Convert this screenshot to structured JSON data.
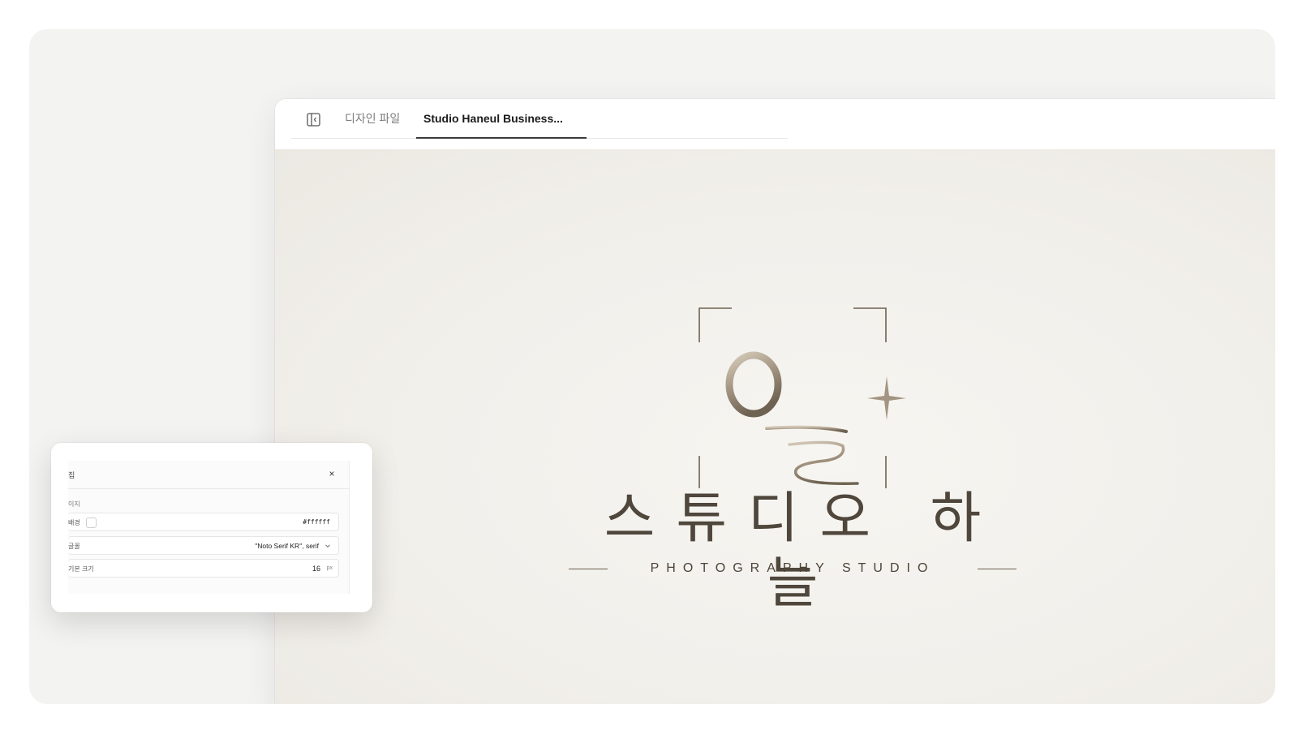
{
  "tabs": {
    "files_label": "디자인 파일",
    "active_label": "Studio Haneul Business..."
  },
  "logo": {
    "korean_name": "스튜디오 하늘",
    "tagline": "PHOTOGRAPHY STUDIO",
    "mark_glyph": "하늘",
    "colors": {
      "gold_light": "#c8bba8",
      "gold_dark": "#6e6252",
      "ink": "#4f463c"
    }
  },
  "settings_panel": {
    "title": "집",
    "close_icon": "×",
    "section_label": "이지",
    "background": {
      "label": "배경",
      "value": "#ffffff"
    },
    "font": {
      "label": "글꼴",
      "value": "\"Noto Serif KR\", serif"
    },
    "base_size": {
      "label": "기본 크기",
      "value": "16",
      "unit": "px"
    }
  },
  "icons": {
    "sidebar_toggle": "sidebar-collapse-icon",
    "dropdown": "chevron-down-icon",
    "sparkle": "sparkle-icon"
  }
}
